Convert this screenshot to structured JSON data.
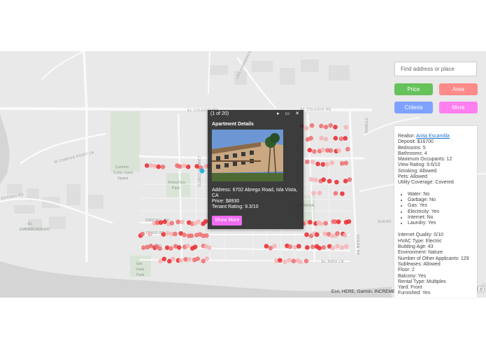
{
  "search": {
    "placeholder": "Find address or place"
  },
  "filter_buttons": {
    "price": {
      "label": "Price",
      "color": "#66c25a"
    },
    "area": {
      "label": "Area",
      "color": "#ff8a8a"
    },
    "criteria": {
      "label": "Criteria",
      "color": "#7fa2ff"
    },
    "more": {
      "label": "More",
      "color": "#ff7ef0"
    }
  },
  "map": {
    "roads": {
      "el_colegio_1": "EL COLEGIO RD",
      "el_colegio_2": "EL COLEGIO RD",
      "w_campus_point": "W CAMPUS POINT LN",
      "camino_corto": "CAMINO CORTO",
      "los_carneros": "LOS CARNEROS RD",
      "pardall": "PARDALL RD",
      "trigo": "TRIGO RD",
      "sabado_tarde": "SABADO",
      "del_playa": "DEL PLAYA DR",
      "ocean": "OCEAN RD",
      "camino_del_sur": "CAMINO DEL SUR",
      "el_nido": "EL NIDO LN",
      "storke": "STORKE",
      "estero": "ESTERO RD",
      "sueno": "SUENO"
    },
    "places": {
      "camino_corto_space": [
        "Camino",
        "Corto Open",
        "Space"
      ],
      "anisq_park": [
        "Anisq'Oyo",
        "Park"
      ],
      "isla_vista_park": [
        "Isla",
        "Vista",
        "Park"
      ],
      "el_embarcadero": [
        "EL",
        "EMBARCADERO"
      ],
      "la_brisa": "LA BRISA"
    },
    "marker_colors": {
      "strong": "#e8282c",
      "medium": "#ef6c6f",
      "light": "#f6b3b4"
    },
    "zoom": {
      "in": "+",
      "out": "−"
    },
    "attribution": "Esri, HERE, Garmin, INCREMENT P, NGA, USGS | Esri, HERE",
    "logo": "esri"
  },
  "popup": {
    "counter": "(1 of 20)",
    "controls": {
      "next": "▸",
      "maximize": "▭",
      "close": "✕"
    },
    "title": "Apartment Details",
    "address": "Address: 6702 Abrego Road, Isla Vista, CA",
    "price": "Price: $8930",
    "tenant_rating": "Tenant Rating: 9.3/10",
    "show_more": "Show More"
  },
  "details": {
    "realtor_label": "Realtor:",
    "realtor_name": "Anita Escamilla",
    "lines_top": [
      "Deposit: $16700",
      "Bedrooms: 5",
      "Bathrooms: 4",
      "Maximum Occupants: 12",
      "View Rating: 9.6/10",
      "Smoking: Allowed",
      "Pets: Allowed",
      "Utility Coverage: Covered"
    ],
    "utilities": [
      "Water: No",
      "Garbage: No",
      "Gas: Yes",
      "Electricity: Yes",
      "Internet: No",
      "Laundry: Yes"
    ],
    "lines_bottom": [
      "Internet Quality: 0/10",
      "HVAC Type: Electric",
      "Building Age: 43",
      "Environment: Nature",
      "Number of Other Applicants: 129",
      "Subleases: Allowed",
      "Floor: 2",
      "Balcony: Yes",
      "Rental Type: Multiplex",
      "Yard: Front",
      "Furnished: Yes"
    ]
  }
}
